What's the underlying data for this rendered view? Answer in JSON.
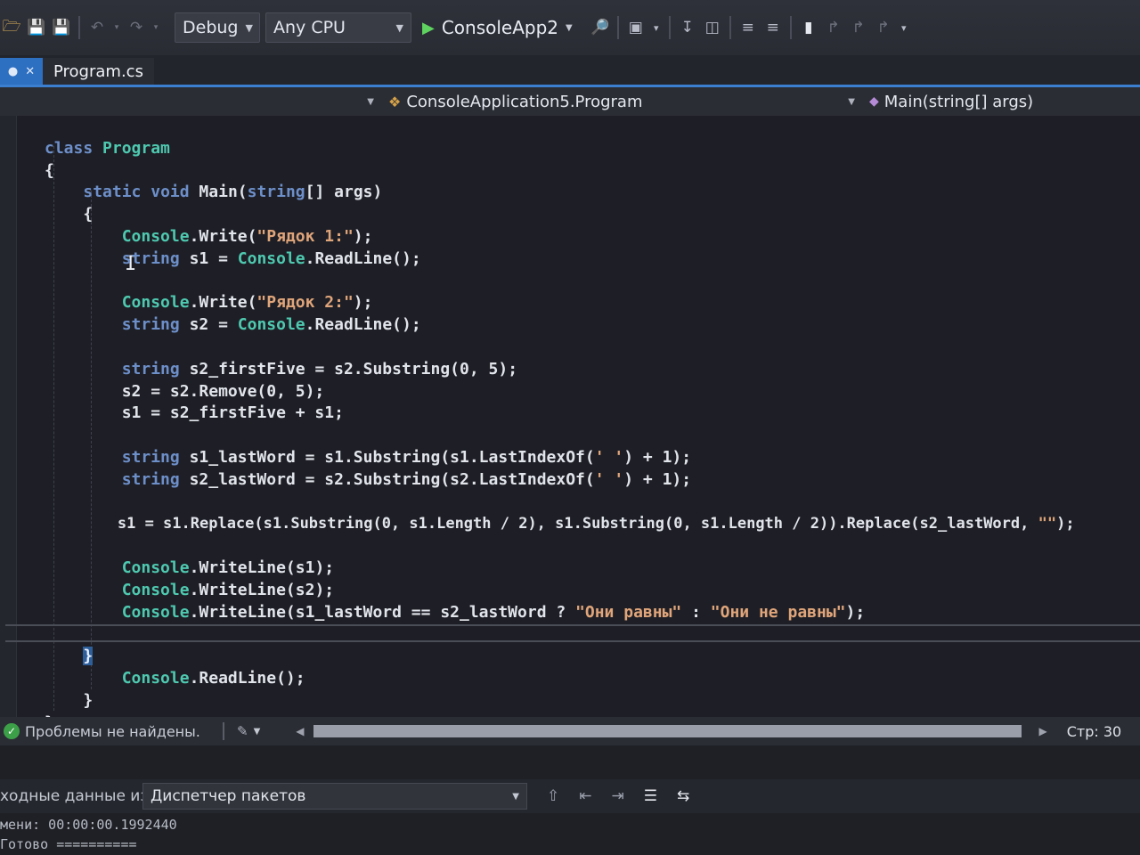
{
  "toolbar": {
    "config": "Debug",
    "platform": "Any CPU",
    "start_project": "ConsoleApp2"
  },
  "tabs": {
    "active": "Program.cs"
  },
  "navbar": {
    "project": "",
    "type": "ConsoleApplication5.Program",
    "member": "Main(string[] args)"
  },
  "status": {
    "issues": "Проблемы не найдены.",
    "line": "Стр: 30",
    "scroll_fraction": 1.0
  },
  "output": {
    "source_label": "ходные данные из:",
    "source": "Диспетчер пакетов",
    "elapsed": "мени: 00:00:00.1992440",
    "done": "Готово =========="
  },
  "icons": [
    "folder-icon",
    "save-icon",
    "save-all-icon",
    "undo-icon",
    "redo-icon",
    "play-icon",
    "find-icon",
    "screenshot-icon",
    "bookmark-icon",
    "brush-icon",
    "ok-icon"
  ],
  "colors": {
    "accent": "#3b7fd1",
    "keyword": "#6d8fc9",
    "type": "#4ec9b0",
    "string": "#e0a57a"
  }
}
